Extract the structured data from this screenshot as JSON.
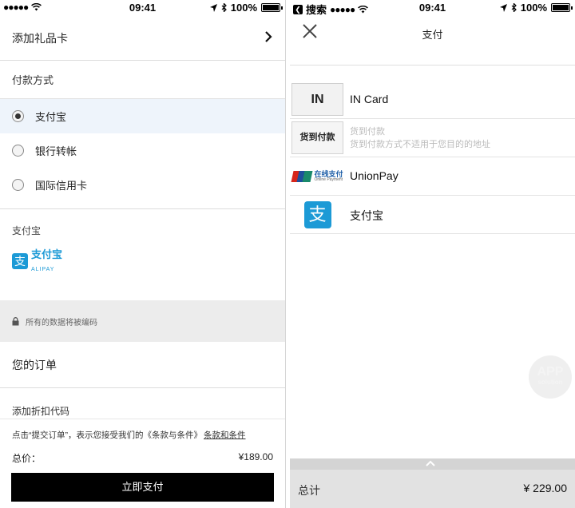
{
  "left_screen": {
    "status_bar": {
      "signal": "●●●●●",
      "time": "09:41",
      "battery": "100%"
    },
    "gift_card": {
      "label": "添加礼品卡"
    },
    "payment_method": {
      "heading": "付款方式",
      "options": [
        {
          "label": "支付宝",
          "selected": true
        },
        {
          "label": "银行转帐",
          "selected": false
        },
        {
          "label": "国际信用卡",
          "selected": false
        }
      ]
    },
    "alipay_section": {
      "label": "支付宝",
      "logo_text": "支付宝",
      "logo_sub": "ALIPAY",
      "logo_glyph": "支"
    },
    "secure_note": "所有的数据将被编码",
    "order": {
      "title": "您的订单",
      "discount_label": "添加折扣代码"
    },
    "checkout": {
      "terms_text": "点击“提交订单”，表示您接受我们的《条款与条件》",
      "terms_link": "条款和条件",
      "total_label": "总价：",
      "total_value": "¥189.00",
      "pay_button": "立即支付"
    }
  },
  "right_screen": {
    "status_bar": {
      "back_app": "搜索",
      "signal": "●●●●●",
      "time": "09:41",
      "battery": "100%"
    },
    "title": "支付",
    "methods": [
      {
        "icon_text": "IN",
        "name": "IN Card"
      },
      {
        "icon_text": "货到付款",
        "name": "货到付款",
        "note": "货到付款方式不适用于您目的的地址"
      },
      {
        "icon_text": "在线支付",
        "icon_sub": "Online Payment",
        "name": "UnionPay"
      },
      {
        "icon_text": "支",
        "name": "支付宝"
      }
    ],
    "watermark": {
      "line1": "APP",
      "line2": "solution"
    },
    "footer": {
      "label": "总计",
      "amount": "¥ 229.00"
    }
  },
  "colors": {
    "alipay_blue": "#1c9ad6",
    "unionpay_blue": "#1f5fa8",
    "selected_row": "#eef4fb"
  }
}
